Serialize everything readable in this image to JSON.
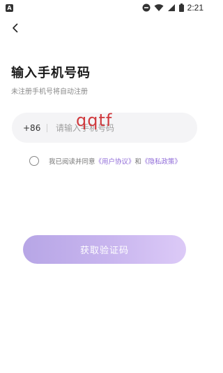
{
  "status_bar": {
    "app_badge": "A",
    "time": "2:21"
  },
  "header": {
    "title": "输入手机号码",
    "subtitle": "未注册手机号将自动注册"
  },
  "phone": {
    "country_code": "+86",
    "placeholder": "请输入手机号码",
    "value": ""
  },
  "overlay": {
    "text": "qqtf"
  },
  "agreement": {
    "prefix": "我已阅读并同意",
    "user_agreement": "《用户协议》",
    "conjunction": "和",
    "privacy_policy": "《隐私政策》",
    "checked": false
  },
  "actions": {
    "get_code_label": "获取验证码"
  },
  "colors": {
    "accent": "#8f6ad8",
    "button_start": "#b7a6e6",
    "button_end": "#dccaf7"
  }
}
